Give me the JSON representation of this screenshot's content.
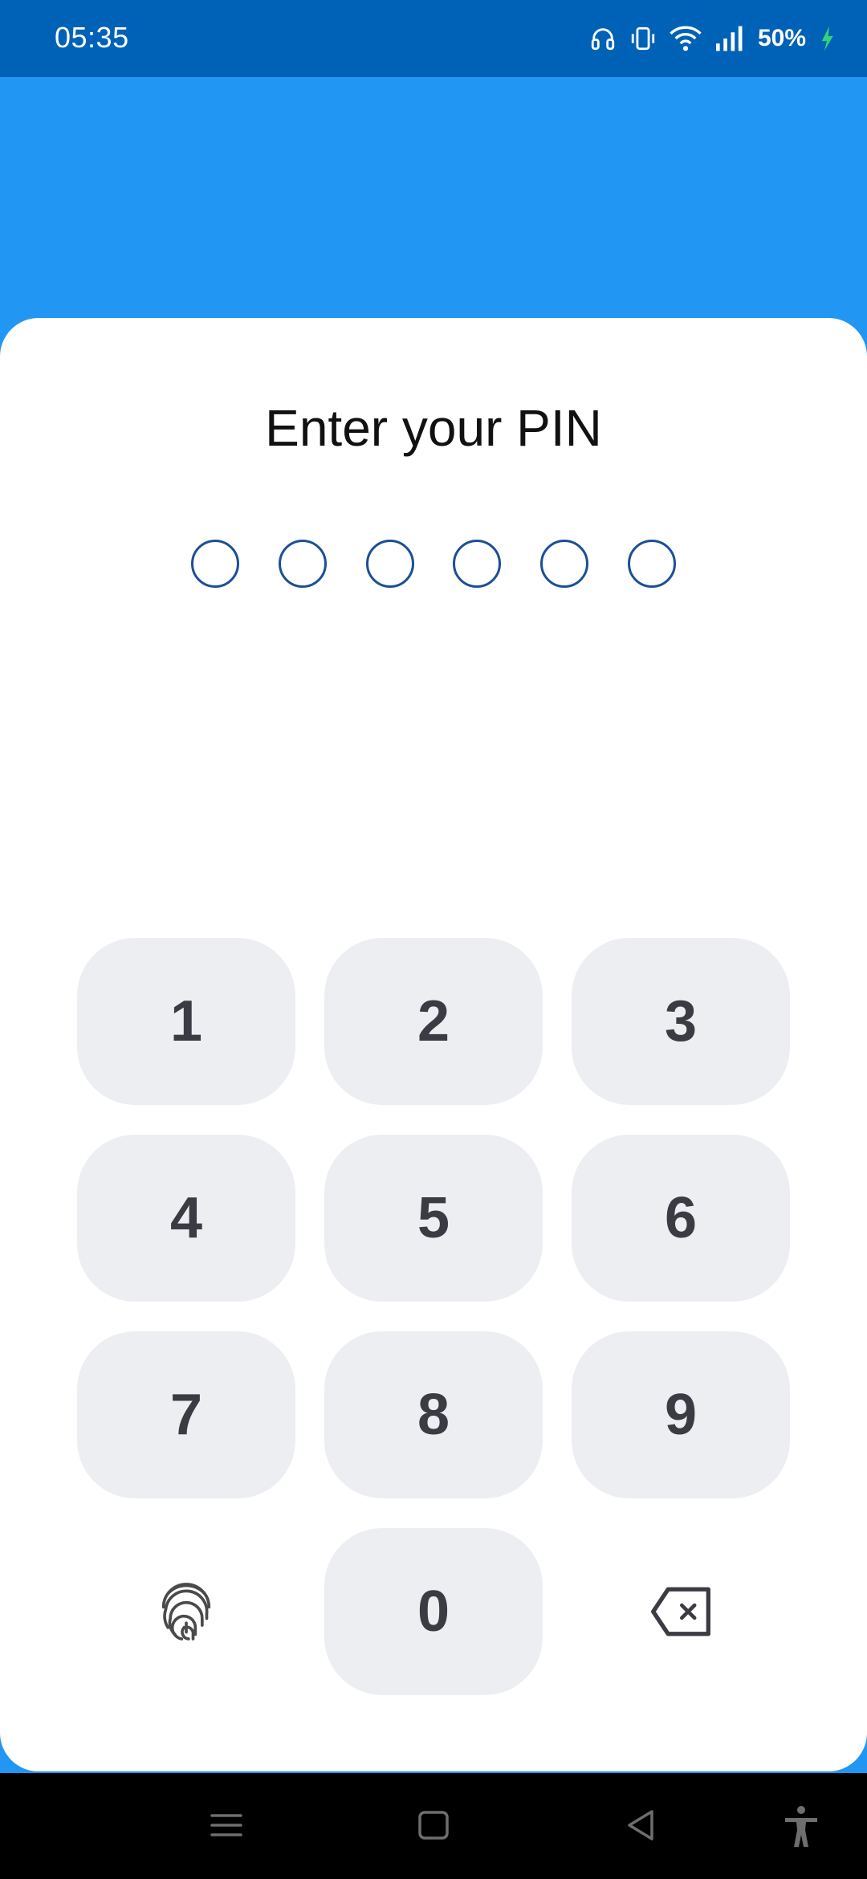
{
  "status_bar": {
    "time": "05:35",
    "battery": "50%",
    "icons": [
      "headphones-icon",
      "vibrate-icon",
      "wifi-icon",
      "signal-icon",
      "charging-icon"
    ]
  },
  "pin_screen": {
    "title": "Enter your PIN",
    "pin_length": 6,
    "entered_digits": 0
  },
  "keypad": {
    "keys": [
      "1",
      "2",
      "3",
      "4",
      "5",
      "6",
      "7",
      "8",
      "9",
      "0"
    ],
    "fingerprint_icon": "fingerprint-icon",
    "backspace_icon": "backspace-icon"
  },
  "navigation_bar": {
    "buttons": [
      "menu-icon",
      "home-icon",
      "back-icon",
      "accessibility-icon"
    ]
  },
  "colors": {
    "status_bar": "#0062b6",
    "header": "#2196f3",
    "dot_outline": "#1c4f96",
    "key_background": "#eceef1",
    "key_text": "#3b3c43"
  }
}
